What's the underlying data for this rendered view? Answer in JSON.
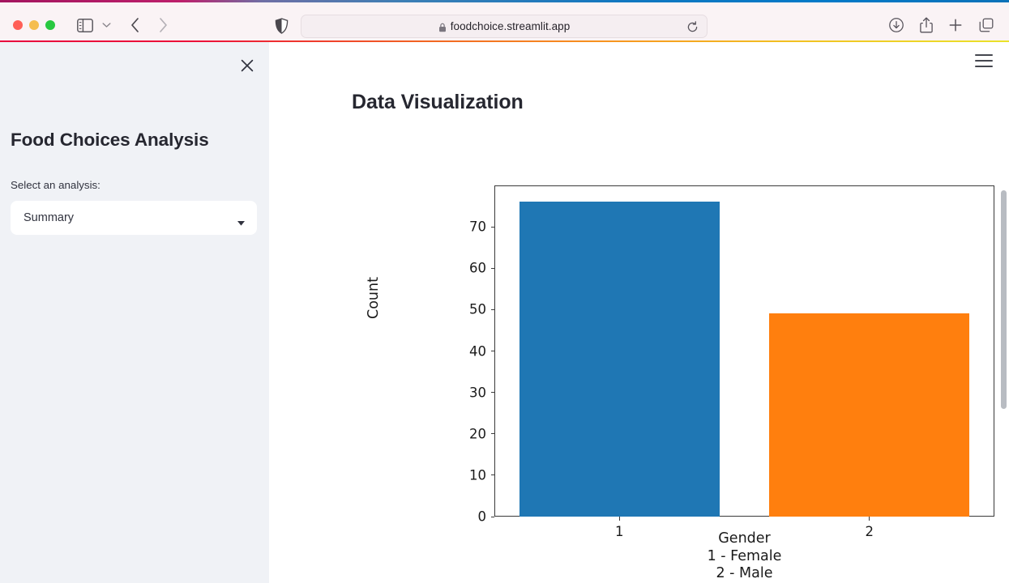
{
  "browser": {
    "name": "safari",
    "traffic_lights": [
      "close",
      "minimize",
      "zoom"
    ],
    "sidebar_toggle_icon": "sidebar-icon",
    "sidebar_caret_icon": "chevron-down-icon",
    "back_icon": "chevron-left-icon",
    "forward_icon": "chevron-right-icon",
    "privacy_icon": "shield-icon",
    "address": {
      "lock_icon": "lock-icon",
      "url": "foodchoice.streamlit.app",
      "reload_icon": "reload-icon"
    },
    "toolbar": {
      "downloads_icon": "downloads-icon",
      "share_icon": "share-icon",
      "new_tab_icon": "plus-icon",
      "tab_overview_icon": "tab-overview-icon"
    },
    "accent_top_start": "#a3155f",
    "accent_top_end": "#0079c8",
    "accent_bottom_start": "#e8003c",
    "accent_bottom_end": "#eae22a"
  },
  "sidebar": {
    "close_icon": "close-icon",
    "title": "Food Choices Analysis",
    "select_label": "Select an analysis:",
    "select_value": "Summary",
    "select_caret_icon": "caret-down-icon",
    "background_color": "#f0f2f6"
  },
  "main": {
    "hamburger_icon": "hamburger-menu-icon",
    "heading": "Data Visualization",
    "fullscreen_icon": "fullscreen-expand-icon"
  },
  "chart_data": {
    "type": "bar",
    "title": "",
    "categories": [
      "1",
      "2"
    ],
    "values": [
      76,
      49
    ],
    "colors": [
      "#1f77b4",
      "#ff7f0e"
    ],
    "xlabel": "Gender\n1 - Female\n2 - Male",
    "xlabel_lines": [
      "Gender",
      "1 - Female",
      "2 - Male"
    ],
    "ylabel": "Count",
    "ylim": [
      0,
      80
    ],
    "yticks": [
      0,
      10,
      20,
      30,
      40,
      50,
      60,
      70
    ],
    "ytick_labels": [
      "0",
      "10",
      "20",
      "30",
      "40",
      "50",
      "60",
      "70"
    ],
    "xtick_labels": [
      "1",
      "2"
    ],
    "grid": false,
    "legend": false
  }
}
